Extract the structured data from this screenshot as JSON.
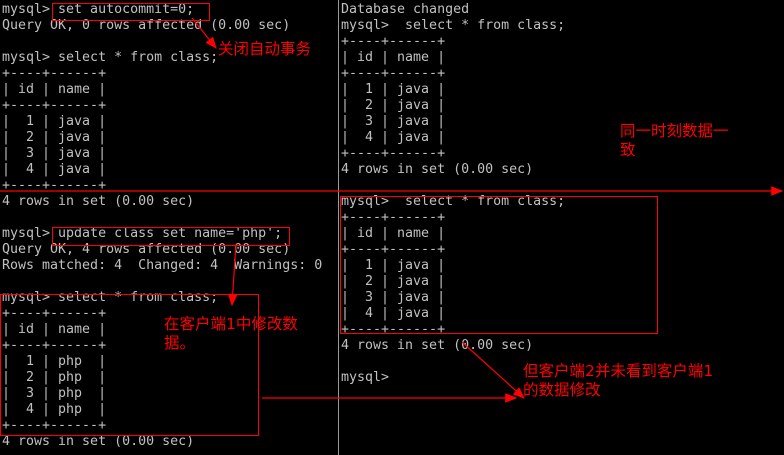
{
  "client1": {
    "lines": [
      "mysql> set autocommit=0;",
      "Query OK, 0 rows affected (0.00 sec)",
      "",
      "mysql> select * from class;",
      "+----+------+",
      "| id | name |",
      "+----+------+",
      "|  1 | java |",
      "|  2 | java |",
      "|  3 | java |",
      "|  4 | java |",
      "+----+------+",
      "4 rows in set (0.00 sec)",
      "",
      "mysql> update class set name='php';",
      "Query OK, 4 rows affected (0.00 sec)",
      "Rows matched: 4  Changed: 4  Warnings: 0",
      "",
      "mysql> select * from class;",
      "+----+------+",
      "| id | name |",
      "+----+------+",
      "|  1 | php  |",
      "|  2 | php  |",
      "|  3 | php  |",
      "|  4 | php  |",
      "+----+------+",
      "4 rows in set (0.00 sec)"
    ]
  },
  "client2": {
    "lines": [
      "Database changed",
      "mysql>  select * from class;",
      "+----+------+",
      "| id | name |",
      "+----+------+",
      "|  1 | java |",
      "|  2 | java |",
      "|  3 | java |",
      "|  4 | java |",
      "+----+------+",
      "4 rows in set (0.00 sec)",
      "",
      "mysql>  select * from class;",
      "+----+------+",
      "| id | name |",
      "+----+------+",
      "|  1 | java |",
      "|  2 | java |",
      "|  3 | java |",
      "|  4 | java |",
      "+----+------+",
      "4 rows in set (0.00 sec)",
      "",
      "mysql>"
    ]
  },
  "annotations": {
    "autocommit_note": "关闭自动事务",
    "same_time_note_line1": "同一时刻数据一",
    "same_time_note_line2": "致",
    "modify_note_line1": "在客户端1中修改数",
    "modify_note_line2": "据。",
    "client2_note_line1": "但客户端2并未看到客户端1",
    "client2_note_line2": "的数据修改"
  },
  "colors": {
    "background": "#000000",
    "terminal_text": "#c0c0c0",
    "annotation": "#ff0000"
  }
}
